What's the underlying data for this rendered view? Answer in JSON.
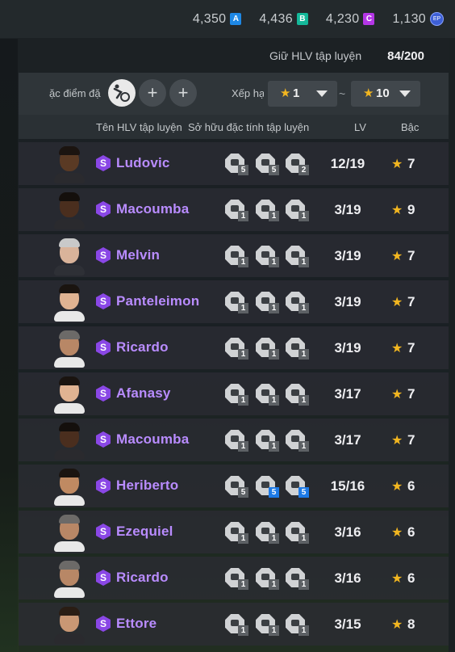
{
  "currency": [
    {
      "amount": "4,350",
      "badge": "A",
      "color": "#1e88e5"
    },
    {
      "amount": "4,436",
      "badge": "B",
      "color": "#14b89a"
    },
    {
      "amount": "4,230",
      "badge": "C",
      "color": "#b436e6"
    },
    {
      "amount": "1,130",
      "badge": "EP",
      "color": "#3d5fd6"
    }
  ],
  "coach_count": {
    "label": "Giữ HLV tập luyện",
    "value": "84/200"
  },
  "filter": {
    "trait_label": "ặc điểm đặ",
    "add_symbol": "+",
    "sort_label": "Xếp hạ",
    "rank_from": "1",
    "rank_to": "10",
    "separator": "~"
  },
  "columns": {
    "name": "Tên HLV tập luyện",
    "traits": "Sở hữu đặc tính tập luyện",
    "lv": "LV",
    "rank": "Bậc"
  },
  "grade_badge": "S",
  "rows": [
    {
      "name": "Ludovic",
      "lv": "12/19",
      "rank": "7",
      "skin": "#5a3a24",
      "shirt": "#2a2a2e",
      "hair": "#1b1410",
      "traits": [
        {
          "count": "5",
          "blue": false
        },
        {
          "count": "5",
          "blue": false
        },
        {
          "count": "2",
          "blue": false
        }
      ]
    },
    {
      "name": "Macoumba",
      "lv": "3/19",
      "rank": "9",
      "skin": "#4a2e1e",
      "shirt": "#2a2a2e",
      "hair": "#140f0c",
      "traits": [
        {
          "count": "1",
          "blue": false
        },
        {
          "count": "1",
          "blue": false
        },
        {
          "count": "1",
          "blue": false
        }
      ]
    },
    {
      "name": "Melvin",
      "lv": "3/19",
      "rank": "7",
      "skin": "#d9b39a",
      "shirt": "#2e3036",
      "hair": "#c9c9c9",
      "traits": [
        {
          "count": "1",
          "blue": false
        },
        {
          "count": "1",
          "blue": false
        },
        {
          "count": "1",
          "blue": false
        }
      ]
    },
    {
      "name": "Panteleimon",
      "lv": "3/19",
      "rank": "7",
      "skin": "#e0b392",
      "shirt": "#e8e8e8",
      "hair": "#1a1410",
      "traits": [
        {
          "count": "1",
          "blue": false
        },
        {
          "count": "1",
          "blue": false
        },
        {
          "count": "1",
          "blue": false
        }
      ]
    },
    {
      "name": "Ricardo",
      "lv": "3/19",
      "rank": "7",
      "skin": "#b88766",
      "shirt": "#e8e8e8",
      "hair": "#6c6a68",
      "traits": [
        {
          "count": "1",
          "blue": false
        },
        {
          "count": "1",
          "blue": false
        },
        {
          "count": "1",
          "blue": false
        }
      ]
    },
    {
      "name": "Afanasy",
      "lv": "3/17",
      "rank": "7",
      "skin": "#e0b392",
      "shirt": "#e8e8e8",
      "hair": "#1a1410",
      "traits": [
        {
          "count": "1",
          "blue": false
        },
        {
          "count": "1",
          "blue": false
        },
        {
          "count": "1",
          "blue": false
        }
      ]
    },
    {
      "name": "Macoumba",
      "lv": "3/17",
      "rank": "7",
      "skin": "#4a2e1e",
      "shirt": "#2a2a2e",
      "hair": "#140f0c",
      "traits": [
        {
          "count": "1",
          "blue": false
        },
        {
          "count": "1",
          "blue": false
        },
        {
          "count": "1",
          "blue": false
        }
      ]
    },
    {
      "name": "Heriberto",
      "lv": "15/16",
      "rank": "6",
      "skin": "#c08a62",
      "shirt": "#e8e8e8",
      "hair": "#1a1410",
      "traits": [
        {
          "count": "5",
          "blue": false
        },
        {
          "count": "5",
          "blue": true
        },
        {
          "count": "5",
          "blue": true
        }
      ]
    },
    {
      "name": "Ezequiel",
      "lv": "3/16",
      "rank": "6",
      "skin": "#b88766",
      "shirt": "#e8e8e8",
      "hair": "#6c6a68",
      "traits": [
        {
          "count": "1",
          "blue": false
        },
        {
          "count": "1",
          "blue": false
        },
        {
          "count": "1",
          "blue": false
        }
      ]
    },
    {
      "name": "Ricardo",
      "lv": "3/16",
      "rank": "6",
      "skin": "#b88766",
      "shirt": "#e8e8e8",
      "hair": "#6c6a68",
      "traits": [
        {
          "count": "1",
          "blue": false
        },
        {
          "count": "1",
          "blue": false
        },
        {
          "count": "1",
          "blue": false
        }
      ]
    },
    {
      "name": "Ettore",
      "lv": "3/15",
      "rank": "8",
      "skin": "#c99774",
      "shirt": "#2a2a2e",
      "hair": "#2a1d14",
      "traits": [
        {
          "count": "1",
          "blue": false
        },
        {
          "count": "1",
          "blue": false
        },
        {
          "count": "1",
          "blue": false
        }
      ]
    }
  ]
}
